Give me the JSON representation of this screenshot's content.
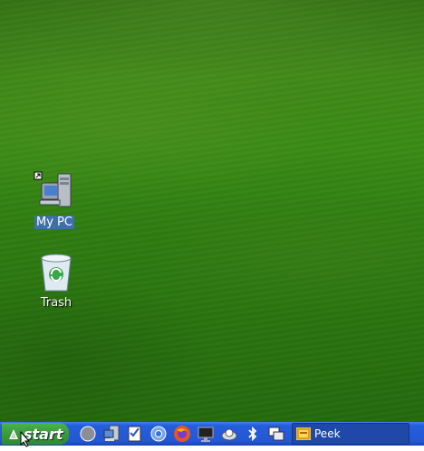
{
  "desktop": {
    "icons": [
      {
        "label": "My PC",
        "icon": "computer-icon"
      },
      {
        "label": "Trash",
        "icon": "recycle-bin-icon"
      }
    ]
  },
  "taskbar": {
    "start_label": "start",
    "quick_launch": [
      "compass-icon",
      "network-computer-icon",
      "task-checklist-icon",
      "chromium-icon",
      "firefox-icon",
      "monitor-icon",
      "disk-icon",
      "bluetooth-icon",
      "windows-icon"
    ],
    "tasks": [
      {
        "label": "Peek",
        "icon": "peek-icon"
      }
    ]
  },
  "colors": {
    "taskbar": "#245edb",
    "start": "#3c9a3c"
  }
}
